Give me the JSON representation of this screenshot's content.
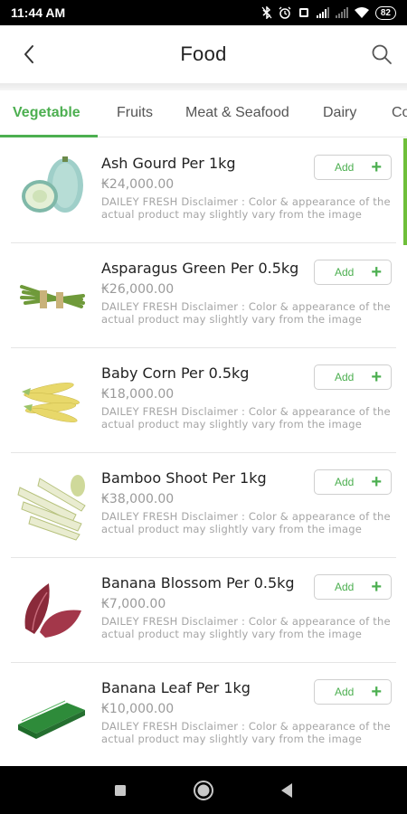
{
  "status_bar": {
    "time": "11:44 AM",
    "battery": "82",
    "icons": [
      "bluetooth-icon",
      "alarm-icon",
      "vibrate-icon",
      "signal-icon",
      "signal-icon",
      "wifi-icon",
      "battery-icon"
    ]
  },
  "header": {
    "title": "Food",
    "back_icon": "chevron-left-icon",
    "search_icon": "search-icon"
  },
  "tabs": [
    {
      "label": "Vegetable",
      "active": true
    },
    {
      "label": "Fruits",
      "active": false
    },
    {
      "label": "Meat & Seafood",
      "active": false
    },
    {
      "label": "Dairy",
      "active": false
    },
    {
      "label": "Co",
      "active": false
    }
  ],
  "accent_color": "#4caf50",
  "products": [
    {
      "name": "Ash Gourd Per 1kg",
      "price": "₭24,000.00",
      "disclaimer": "DAILEY FRESH Disclaimer : Color & appearance of the actual product may slightly vary from the image",
      "add_label": "Add",
      "add_symbol": "+",
      "image": "ash-gourd-image"
    },
    {
      "name": "Asparagus Green Per 0.5kg",
      "price": "₭26,000.00",
      "disclaimer": "DAILEY FRESH Disclaimer : Color & appearance of the actual product may slightly vary from the image",
      "add_label": "Add",
      "add_symbol": "+",
      "image": "asparagus-image"
    },
    {
      "name": "Baby Corn Per 0.5kg",
      "price": "₭18,000.00",
      "disclaimer": "DAILEY FRESH Disclaimer : Color & appearance of the actual product may slightly vary from the image",
      "add_label": "Add",
      "add_symbol": "+",
      "image": "baby-corn-image"
    },
    {
      "name": "Bamboo Shoot Per 1kg",
      "price": "₭38,000.00",
      "disclaimer": "DAILEY FRESH Disclaimer : Color & appearance of the actual product may slightly vary from the image",
      "add_label": "Add",
      "add_symbol": "+",
      "image": "bamboo-shoot-image"
    },
    {
      "name": "Banana Blossom Per 0.5kg",
      "price": "₭7,000.00",
      "disclaimer": "DAILEY FRESH Disclaimer : Color & appearance of the actual product may slightly vary from the image",
      "add_label": "Add",
      "add_symbol": "+",
      "image": "banana-blossom-image"
    },
    {
      "name": "Banana Leaf Per 1kg",
      "price": "₭10,000.00",
      "disclaimer": "DAILEY FRESH Disclaimer : Color & appearance of the actual product may slightly vary from the image",
      "add_label": "Add",
      "add_symbol": "+",
      "image": "banana-leaf-image"
    }
  ],
  "nav_bar": {
    "buttons": [
      "recents-square-icon",
      "home-circle-icon",
      "back-triangle-icon"
    ]
  }
}
